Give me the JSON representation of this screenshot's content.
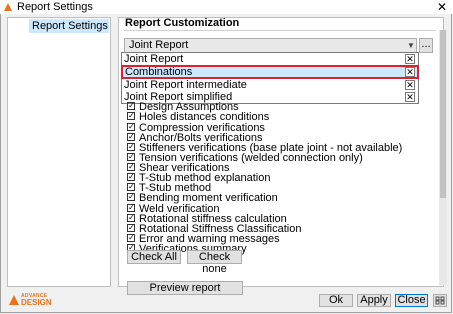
{
  "window": {
    "title": "Report Settings",
    "close_glyph": "✕"
  },
  "sidebar": {
    "items": [
      {
        "label": "Report Settings"
      }
    ]
  },
  "main": {
    "section_title": "Report Customization",
    "combo": {
      "selected": "Joint Report",
      "more_label": "..."
    },
    "dropdown_options": [
      {
        "label": "Joint Report",
        "selected": false
      },
      {
        "label": "Combinations",
        "selected": true
      },
      {
        "label": "Joint Report intermediate",
        "selected": false
      },
      {
        "label": "Joint Report simplified",
        "selected": false
      }
    ],
    "checklist": [
      "Design Assumptions",
      "Holes distances conditions",
      "Compression verifications",
      "Anchor/Bolts verifications",
      "Stiffeners verifications (base plate joint - not available)",
      "Tension verifications (welded connection only)",
      "Shear verifications",
      "T-Stub method explanation",
      "T-Stub method",
      "Bending moment verification",
      "Weld verification",
      "Rotational stiffness calculation",
      "Rotational Stiffness Classification",
      "Error and warning messages",
      "Verifications summary"
    ],
    "check_all_label": "Check All",
    "check_none_label": "Check none",
    "preview_label": "Preview report"
  },
  "footer": {
    "logo_small": "ADVANCE",
    "logo_big": "DESIGN",
    "ok_label": "Ok",
    "apply_label": "Apply",
    "close_label": "Close"
  },
  "colors": {
    "accent": "#0078d7",
    "selection": "#cce8ff",
    "highlight_border": "#d9232d",
    "logo": "#e8711c"
  }
}
